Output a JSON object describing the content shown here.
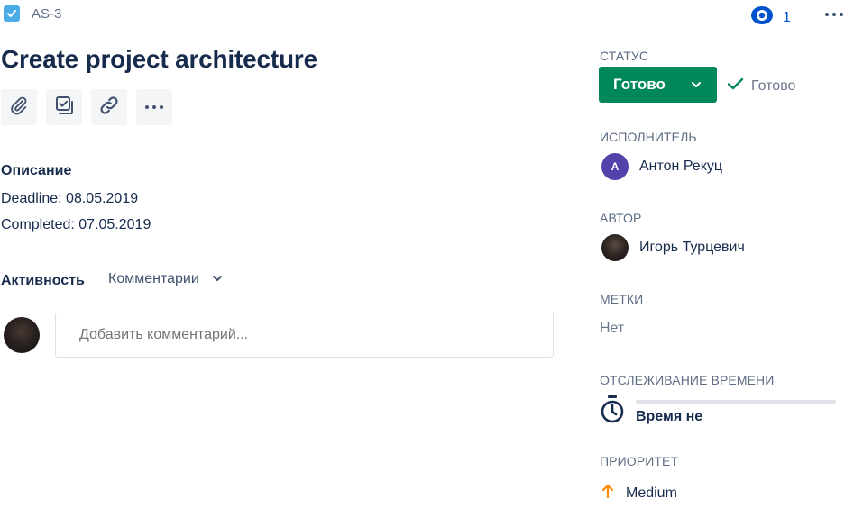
{
  "issue": {
    "key": "AS-3",
    "title": "Create project architecture",
    "type_icon": "checkbox-task-icon"
  },
  "watchers": {
    "icon": "eye-icon",
    "count": "1"
  },
  "toolbar": {
    "actions": [
      {
        "icon": "paperclip-icon"
      },
      {
        "icon": "subtask-icon"
      },
      {
        "icon": "link-icon"
      },
      {
        "icon": "more-icon"
      }
    ]
  },
  "description": {
    "heading": "Описание",
    "lines": [
      "Deadline: 08.05.2019",
      "Completed: 07.05.2019"
    ]
  },
  "activity": {
    "label": "Активность",
    "filter": "Комментарии"
  },
  "comment": {
    "placeholder": "Добавить комментарий..."
  },
  "sidebar": {
    "status": {
      "label": "СТАТУС",
      "value": "Готово",
      "resolution": "Готово"
    },
    "assignee": {
      "label": "ИСПОЛНИТЕЛЬ",
      "initial": "А",
      "name": "Антон Рекуц"
    },
    "reporter": {
      "label": "АВТОР",
      "name": "Игорь Турцевич"
    },
    "labels": {
      "label": "МЕТКИ",
      "value": "Нет"
    },
    "time_tracking": {
      "label": "ОТСЛЕЖИВАНИЕ ВРЕМЕНИ",
      "value": "Время не"
    },
    "priority": {
      "label": "ПРИОРИТЕТ",
      "value": "Medium"
    }
  },
  "colors": {
    "status_done": "#00875a",
    "assignee_avatar": "#5243aa",
    "priority_medium": "#ff8b00",
    "link_blue": "#0052cc",
    "task_icon": "#4bade8"
  }
}
